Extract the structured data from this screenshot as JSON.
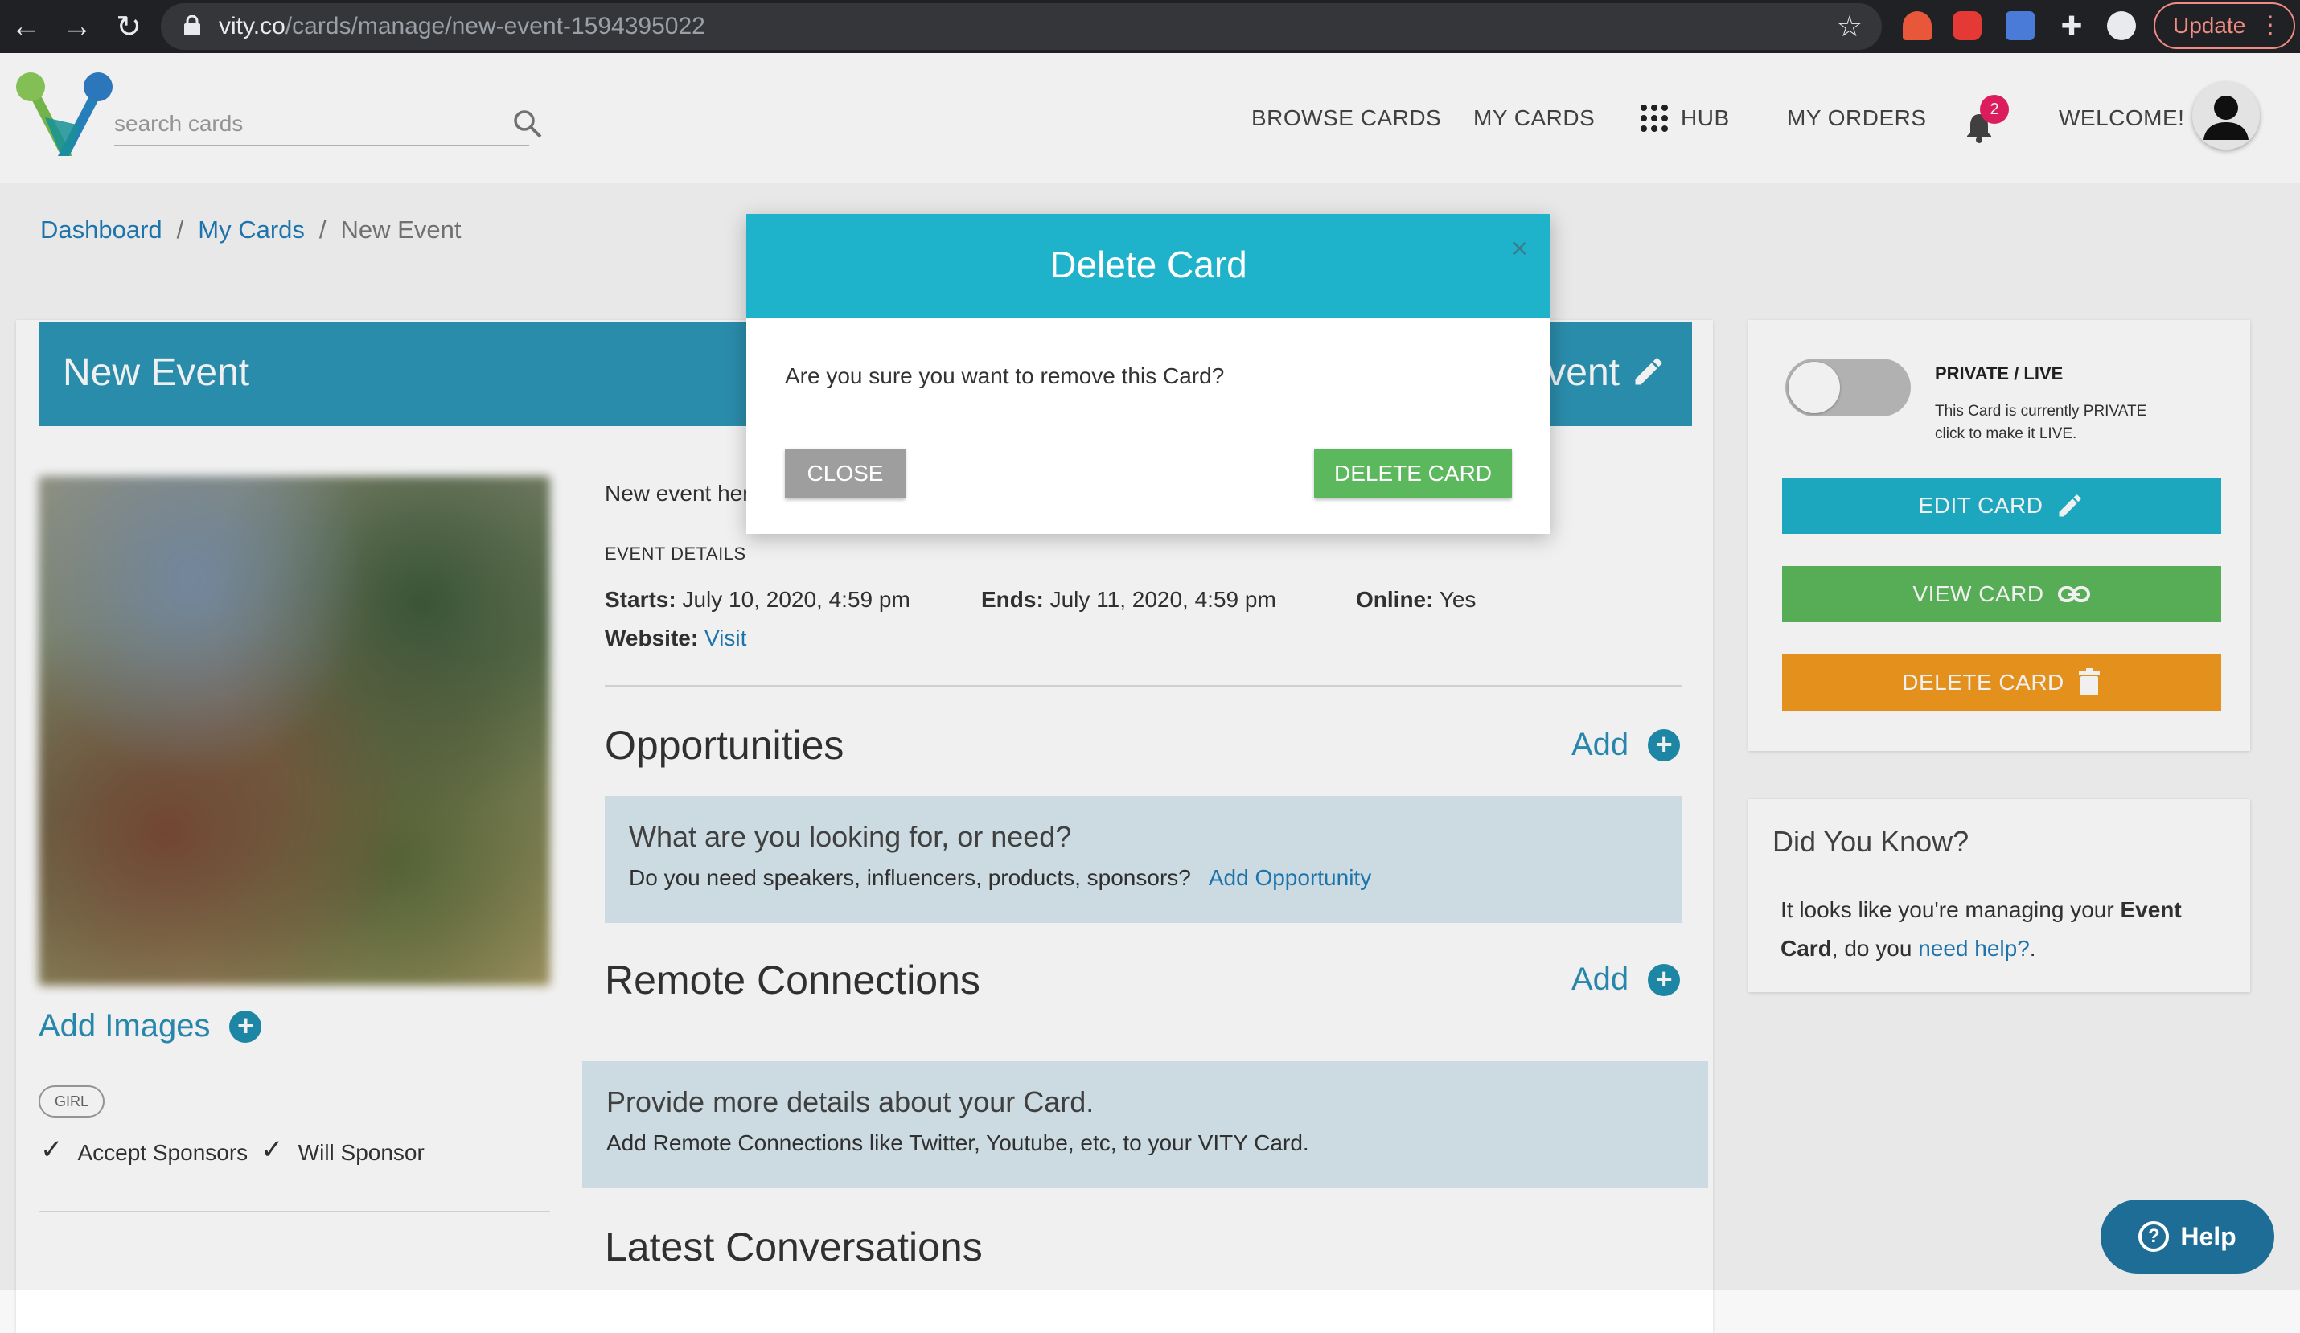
{
  "browser": {
    "url_domain": "vity.co",
    "url_path": "/cards/manage/new-event-1594395022",
    "update_label": "Update",
    "colors": {
      "update": "#f28b82"
    }
  },
  "header": {
    "search_placeholder": "search cards",
    "nav": {
      "browse": "BROWSE CARDS",
      "my_cards": "MY CARDS",
      "hub": "HUB",
      "my_orders": "MY ORDERS",
      "welcome": "WELCOME!"
    },
    "notification_count": "2"
  },
  "breadcrumb": [
    "Dashboard",
    "My Cards",
    "New Event"
  ],
  "card": {
    "title": "New Event",
    "title_tail": "vent",
    "description": "New event her",
    "event_details_heading": "EVENT DETAILS",
    "starts_label": "Starts:",
    "starts_value": "July 10, 2020, 4:59 pm",
    "ends_label": "Ends:",
    "ends_value": "July 11, 2020, 4:59 pm",
    "online_label": "Online:",
    "online_value": "Yes",
    "website_label": "Website:",
    "website_link": "Visit",
    "add_images": "Add Images",
    "tag": "GIRL",
    "accept_sponsors": "Accept Sponsors",
    "will_sponsor": "Will Sponsor"
  },
  "opportunities": {
    "title": "Opportunities",
    "add": "Add",
    "box_heading": "What are you looking for, or need?",
    "box_text": "Do you need speakers, influencers, products, sponsors?",
    "box_link": "Add Opportunity"
  },
  "remote": {
    "title": "Remote Connections",
    "add": "Add",
    "box_heading": "Provide more details about your Card.",
    "box_text": "Add Remote Connections like Twitter, Youtube, etc, to your VITY Card."
  },
  "conversations": {
    "title": "Latest Conversations"
  },
  "sidebar": {
    "privacy_title": "PRIVATE / LIVE",
    "privacy_line1": "This Card is currently PRIVATE",
    "privacy_line2": "click to make it LIVE.",
    "edit_btn": "EDIT CARD",
    "view_btn": "VIEW CARD",
    "delete_btn": "DELETE CARD",
    "colors": {
      "edit": "#1fb2cb",
      "view": "#5cb85c",
      "delete": "#f39a1f"
    },
    "dyk_title": "Did You Know?",
    "dyk_text_a": "It looks like you're managing your ",
    "dyk_text_bold": "Event Card",
    "dyk_text_b": ", do you ",
    "dyk_link": "need help?",
    "dyk_text_c": "."
  },
  "modal": {
    "title": "Delete Card",
    "close_x": "×",
    "message": "Are you sure you want to remove this Card?",
    "close_btn": "CLOSE",
    "delete_btn": "DELETE CARD"
  },
  "help": {
    "label": "Help"
  }
}
